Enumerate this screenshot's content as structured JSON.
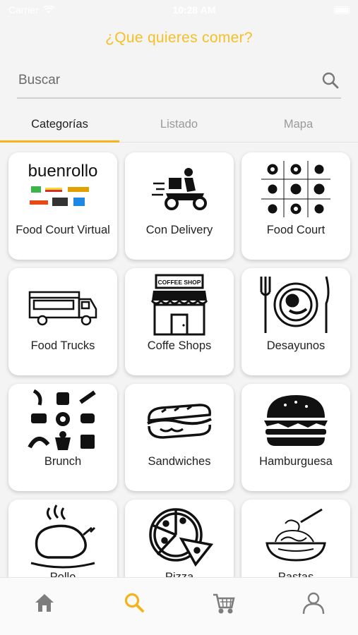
{
  "status_bar": {
    "carrier": "Carrier",
    "time": "10:28 AM"
  },
  "header": {
    "title": "¿Que quieres comer?"
  },
  "search": {
    "placeholder": "Buscar"
  },
  "tabs": [
    {
      "label": "Categorías",
      "active": true
    },
    {
      "label": "Listado",
      "active": false
    },
    {
      "label": "Mapa",
      "active": false
    }
  ],
  "categories": [
    {
      "label": "Food Court Virtual",
      "icon": "buenrollo-logo",
      "logo_text": "buenrollo"
    },
    {
      "label": "Con Delivery",
      "icon": "delivery-scooter-icon"
    },
    {
      "label": "Food Court",
      "icon": "food-court-grid-icon"
    },
    {
      "label": "Food Trucks",
      "icon": "food-truck-icon"
    },
    {
      "label": "Coffe Shops",
      "icon": "coffee-shop-icon",
      "sign_text": "COFFEE SHOP"
    },
    {
      "label": "Desayunos",
      "icon": "breakfast-plate-icon"
    },
    {
      "label": "Brunch",
      "icon": "brunch-grid-icon"
    },
    {
      "label": "Sandwiches",
      "icon": "sandwich-icon"
    },
    {
      "label": "Hamburguesa",
      "icon": "burger-icon"
    },
    {
      "label": "Pollo",
      "icon": "roast-chicken-icon"
    },
    {
      "label": "Pizza",
      "icon": "pizza-icon"
    },
    {
      "label": "Pastas",
      "icon": "pasta-icon"
    }
  ],
  "bottom_nav": [
    {
      "name": "home",
      "icon": "home-icon",
      "active": false
    },
    {
      "name": "search",
      "icon": "search-icon",
      "active": true
    },
    {
      "name": "cart",
      "icon": "cart-icon",
      "active": false
    },
    {
      "name": "profile",
      "icon": "profile-icon",
      "active": false
    }
  ],
  "colors": {
    "accent": "#f5c026",
    "tab_indicator": "#f5b21a",
    "inactive": "#8a8a8a"
  }
}
